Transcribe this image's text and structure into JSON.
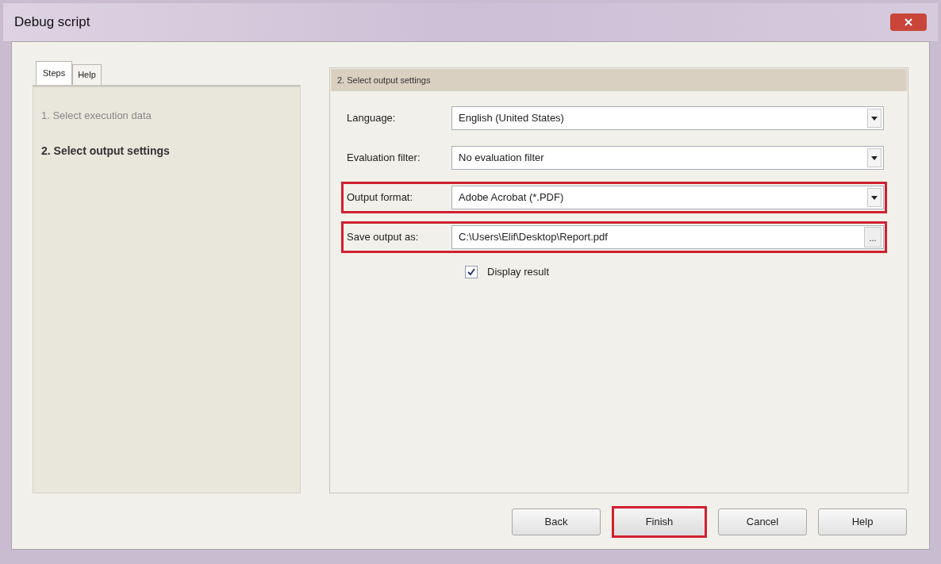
{
  "window": {
    "title": "Debug script"
  },
  "tabs": [
    {
      "label": "Steps",
      "selected": true
    },
    {
      "label": "Help",
      "selected": false
    }
  ],
  "steps": [
    {
      "label": "1. Select execution data",
      "selected": false
    },
    {
      "label": "2. Select output settings",
      "selected": true
    }
  ],
  "panel": {
    "title": "2. Select output settings"
  },
  "fields": [
    {
      "label": "Language:",
      "value": "English (United States)",
      "kind": "dropdown",
      "highlighted": false
    },
    {
      "label": "Evaluation filter:",
      "value": "No evaluation filter",
      "kind": "dropdown",
      "highlighted": false
    },
    {
      "label": "Output format:",
      "value": "Adobe Acrobat (*.PDF)",
      "kind": "dropdown",
      "highlighted": true
    },
    {
      "label": "Save output as:",
      "value": "C:\\Users\\Elif\\Desktop\\Report.pdf",
      "kind": "browse",
      "browse_label": "...",
      "highlighted": true
    }
  ],
  "checkbox": {
    "label": "Display result",
    "checked": true
  },
  "buttons": [
    {
      "label": "Back",
      "highlighted": false
    },
    {
      "label": "Finish",
      "highlighted": true
    },
    {
      "label": "Cancel",
      "highlighted": false
    },
    {
      "label": "Help",
      "highlighted": false
    }
  ]
}
